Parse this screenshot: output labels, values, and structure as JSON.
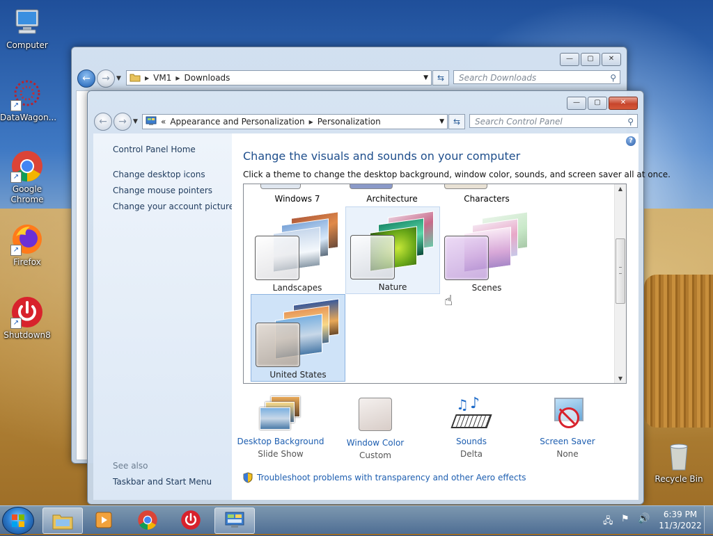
{
  "desktop": {
    "icons": [
      {
        "label": "Computer"
      },
      {
        "label": "DataWagon..."
      },
      {
        "label": "Google Chrome"
      },
      {
        "label": "Firefox"
      },
      {
        "label": "Shutdown8"
      },
      {
        "label": "Recycle Bin"
      }
    ]
  },
  "explorer": {
    "breadcrumb": [
      "VM1",
      "Downloads"
    ],
    "search_placeholder": "Search Downloads"
  },
  "control_panel": {
    "breadcrumb_prefix": "«",
    "breadcrumb": [
      "Appearance and Personalization",
      "Personalization"
    ],
    "search_placeholder": "Search Control Panel",
    "help_label": "?",
    "sidebar": {
      "home": "Control Panel Home",
      "links": [
        "Change desktop icons",
        "Change mouse pointers",
        "Change your account picture"
      ],
      "see_also_label": "See also",
      "see_also_links": [
        "Taskbar and Start Menu"
      ]
    },
    "heading": "Change the visuals and sounds on your computer",
    "subheading": "Click a theme to change the desktop background, window color, sounds, and screen saver all at once.",
    "themes": [
      {
        "label": "Windows 7"
      },
      {
        "label": "Architecture"
      },
      {
        "label": "Characters"
      },
      {
        "label": "Landscapes"
      },
      {
        "label": "Nature"
      },
      {
        "label": "Scenes"
      },
      {
        "label": "United States",
        "selected": true
      }
    ],
    "bottom_items": [
      {
        "label": "Desktop Background",
        "value": "Slide Show"
      },
      {
        "label": "Window Color",
        "value": "Custom"
      },
      {
        "label": "Sounds",
        "value": "Delta"
      },
      {
        "label": "Screen Saver",
        "value": "None"
      }
    ],
    "troubleshoot_link": "Troubleshoot problems with transparency and other Aero effects"
  },
  "taskbar": {
    "time": "6:39 PM",
    "date": "11/3/2022"
  },
  "colors": {
    "link": "#1d5eb0",
    "heading": "#1e4e8c",
    "close_button": "#c7452c"
  }
}
